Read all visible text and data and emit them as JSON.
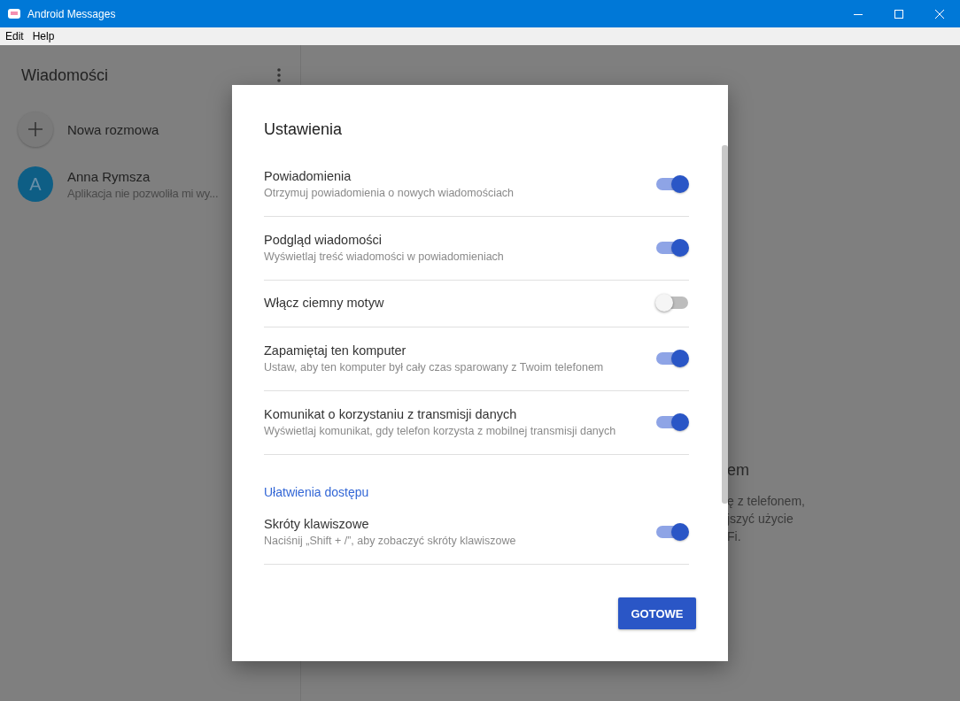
{
  "window": {
    "title": "Android Messages"
  },
  "menu": [
    "Edit",
    "Help"
  ],
  "sidebar": {
    "title": "Wiadomości",
    "new_conversation": "Nowa rozmowa",
    "conversations": [
      {
        "avatar": "A",
        "name": "Anna Rymsza",
        "snippet": "Aplikacja nie pozwoliła mi wy..."
      }
    ]
  },
  "background_pane": {
    "heading": "em",
    "lines": [
      "ę z telefonem,",
      "jszyć użycie",
      "Fi."
    ]
  },
  "dialog": {
    "title": "Ustawienia",
    "items": [
      {
        "kind": "toggle",
        "label": "Powiadomienia",
        "description": "Otrzymuj powiadomienia o nowych wiadomościach",
        "on": true
      },
      {
        "kind": "toggle",
        "label": "Podgląd wiadomości",
        "description": "Wyświetlaj treść wiadomości w powiadomieniach",
        "on": true
      },
      {
        "kind": "toggle",
        "label": "Włącz ciemny motyw",
        "on": false
      },
      {
        "kind": "toggle",
        "label": "Zapamiętaj ten komputer",
        "description": "Ustaw, aby ten komputer był cały czas sparowany z Twoim telefonem",
        "on": true
      },
      {
        "kind": "toggle",
        "label": "Komunikat o korzystaniu z transmisji danych",
        "description": "Wyświetlaj komunikat, gdy telefon korzysta z mobilnej transmisji danych",
        "on": true
      },
      {
        "kind": "section",
        "label": "Ułatwienia dostępu"
      },
      {
        "kind": "toggle",
        "label": "Skróty klawiszowe",
        "description": "Naciśnij „Shift + /”, aby zobaczyć skróty klawiszowe",
        "on": true
      }
    ],
    "button": "GOTOWE"
  }
}
